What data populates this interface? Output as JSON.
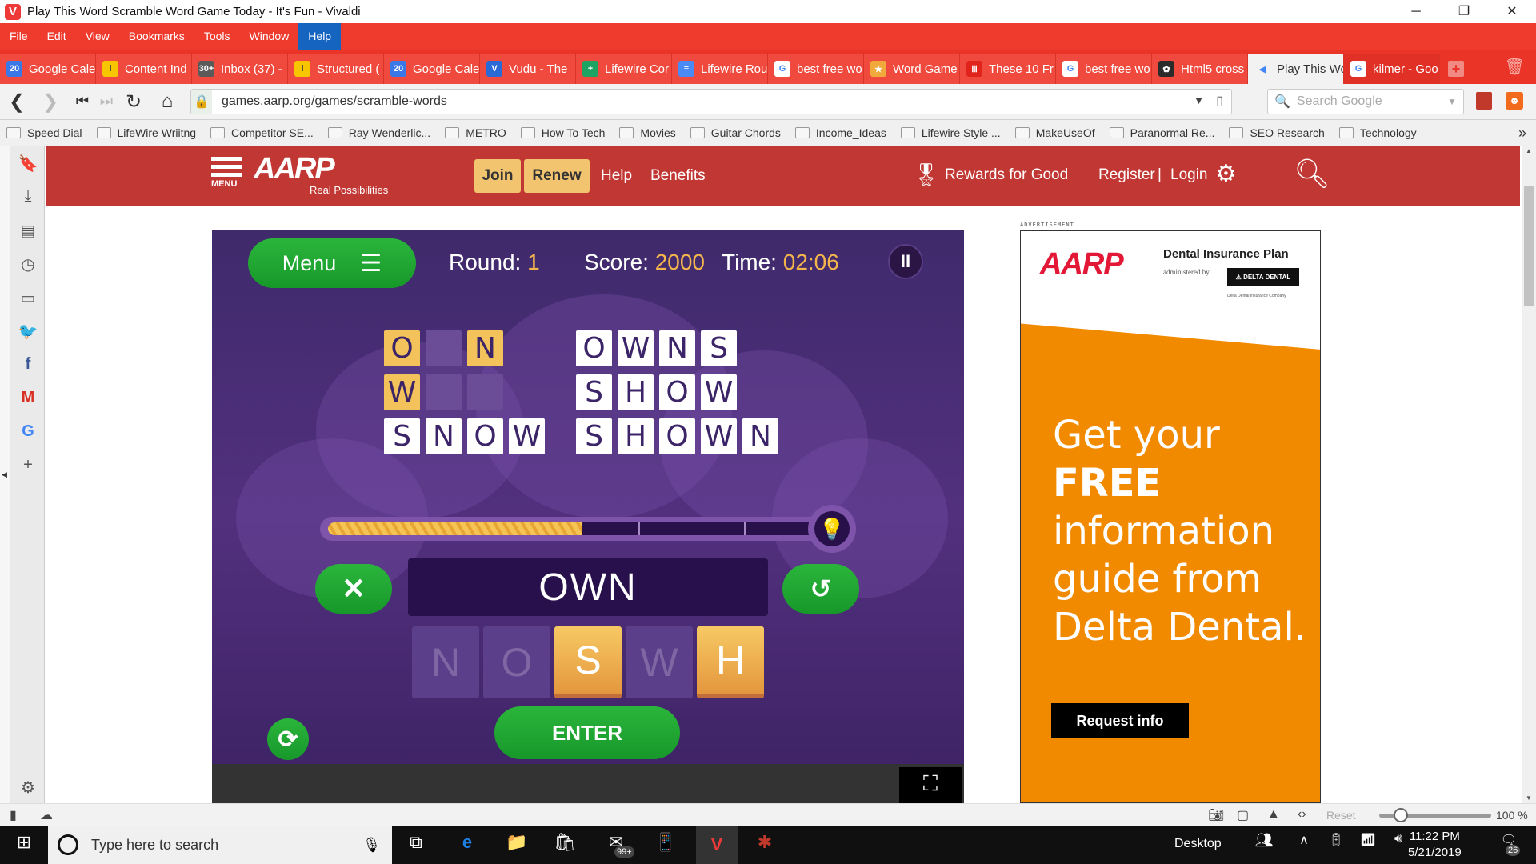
{
  "window": {
    "title": "Play This Word Scramble Word Game Today - It's Fun - Vivaldi",
    "minimize": "─",
    "restore": "❐",
    "close": "✕"
  },
  "menu": [
    "File",
    "Edit",
    "View",
    "Bookmarks",
    "Tools",
    "Window",
    "Help"
  ],
  "tabs": [
    {
      "label": "Google Cale",
      "icon": "20",
      "color": "#3b78e7"
    },
    {
      "label": "Content Ind",
      "icon": "l",
      "color": "#f7c600"
    },
    {
      "label": "Inbox (37) -",
      "icon": "30+",
      "color": "#5a5a5a"
    },
    {
      "label": "Structured (",
      "icon": "l",
      "color": "#f7c600"
    },
    {
      "label": "Google Cale",
      "icon": "20",
      "color": "#3b78e7"
    },
    {
      "label": "Vudu - The",
      "icon": "V",
      "color": "#2a6ad6"
    },
    {
      "label": "Lifewire Cor",
      "icon": "+",
      "color": "#1ea362"
    },
    {
      "label": "Lifewire Rou",
      "icon": "≡",
      "color": "#4a8af4"
    },
    {
      "label": "best free wo",
      "icon": "G",
      "color": "#ffffff"
    },
    {
      "label": "Word Game",
      "icon": "★",
      "color": "#f2a93b"
    },
    {
      "label": "These 10 Fr",
      "icon": "Ⅲ",
      "color": "#e0241b"
    },
    {
      "label": "best free wo",
      "icon": "G",
      "color": "#ffffff"
    },
    {
      "label": "Html5 cross",
      "icon": "✿",
      "color": "#2b2b2b"
    },
    {
      "label": "Play This Wo",
      "icon": "◀",
      "color": "#f2f2f2"
    },
    {
      "label": "kilmer - Goo",
      "icon": "G",
      "color": "#ffffff"
    }
  ],
  "address": {
    "url": "games.aarp.org/games/scramble-words",
    "search_placeholder": "Search Google"
  },
  "bookmarks": [
    "Speed Dial",
    "LifeWire Wriitng",
    "Competitor SE...",
    "Ray Wenderlic...",
    "METRO",
    "How To Tech",
    "Movies",
    "Guitar Chords",
    "Income_Ideas",
    "Lifewire Style ...",
    "MakeUseOf",
    "Paranormal Re...",
    "SEO Research",
    "Technology"
  ],
  "aarp_nav": {
    "menu_label": "MENU",
    "logo": "AARP",
    "tagline": "Real Possibilities",
    "join": "Join",
    "renew": "Renew",
    "help": "Help",
    "benefits": "Benefits",
    "rewards": "Rewards for Good",
    "register": "Register",
    "separator": "|",
    "login": "Login"
  },
  "game": {
    "menu_button": "Menu",
    "round_label": "Round:",
    "round": "1",
    "score_label": "Score:",
    "score": "2000",
    "time_label": "Time:",
    "time": "02:06",
    "words": [
      {
        "letters": [
          "O",
          "",
          "N"
        ],
        "state": "partial",
        "found": [
          true,
          false,
          true
        ]
      },
      {
        "letters": [
          "W",
          "",
          ""
        ],
        "state": "partial",
        "found": [
          true,
          false,
          false
        ]
      },
      {
        "letters": [
          "S",
          "N",
          "O",
          "W"
        ],
        "state": "solved"
      },
      {
        "letters": [
          "O",
          "W",
          "N",
          "S"
        ],
        "state": "solved"
      },
      {
        "letters": [
          "S",
          "H",
          "O",
          "W"
        ],
        "state": "solved"
      },
      {
        "letters": [
          "S",
          "H",
          "O",
          "W",
          "N"
        ],
        "state": "solved"
      }
    ],
    "hint_progress_percent": 52,
    "current_word": "OWN",
    "letter_tiles": [
      {
        "letter": "N",
        "used": true
      },
      {
        "letter": "O",
        "used": true
      },
      {
        "letter": "S",
        "used": false
      },
      {
        "letter": "W",
        "used": true
      },
      {
        "letter": "H",
        "used": false
      }
    ],
    "enter_button": "ENTER"
  },
  "ad": {
    "label": "ADVERTISEMENT",
    "brand": "AARP",
    "plan": "Dental Insurance Plan",
    "administered": "administered by",
    "delta": "⚠ DELTA DENTAL",
    "company": "Delta Dental Insurance Company",
    "line1": "Get your",
    "line2": "FREE",
    "line3": "information",
    "line4": "guide from",
    "line5": "Delta Dental.",
    "cta": "Request info"
  },
  "statusbar": {
    "reset": "Reset",
    "zoom": "100 %",
    "zoom_level_percent": 100
  },
  "taskbar": {
    "search_placeholder": "Type here to search",
    "desktop": "Desktop",
    "mail_badge": "99+",
    "time": "11:22 PM",
    "date": "5/21/2019",
    "notifications": "26"
  },
  "colors": {
    "vivaldi_red": "#ef3b2e",
    "aarp_red": "#c13733",
    "game_purple": "#4a2c75",
    "green": "#1fa433",
    "gold": "#f4b54c",
    "ad_orange": "#f28a00"
  }
}
